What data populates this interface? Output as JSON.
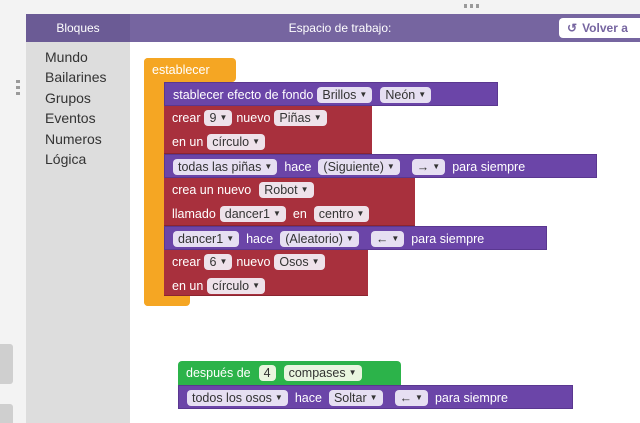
{
  "header": {
    "toolbox_title": "Bloques",
    "workspace_title": "Espacio de trabajo:",
    "back_label": "Volver a"
  },
  "categories": [
    "Mundo",
    "Bailarines",
    "Grupos",
    "Eventos",
    "Numeros",
    "Lógica"
  ],
  "stack1": {
    "hat": "establecer",
    "bg_effect": {
      "text": "stablecer efecto de fondo",
      "value1": "Brillos",
      "value2": "Neón"
    },
    "create1": {
      "text1": "crear",
      "count": "9",
      "text2": "nuevo",
      "kind": "Piñas",
      "text3": "en un",
      "shape": "círculo"
    },
    "all1": {
      "target": "todas las piñas",
      "text1": "hace",
      "move": "(Siguiente)",
      "dir": "→",
      "text2": "para siempre"
    },
    "newdancer": {
      "text1": "crea un nuevo",
      "kind": "Robot",
      "text2": "llamado",
      "name": "dancer1",
      "text3": "en",
      "pos": "centro"
    },
    "dancer1": {
      "target": "dancer1",
      "text1": "hace",
      "move": "(Aleatorio)",
      "dir": "←",
      "text2": "para siempre"
    },
    "create2": {
      "text1": "crear",
      "count": "6",
      "text2": "nuevo",
      "kind": "Osos",
      "text3": "en un",
      "shape": "círculo"
    }
  },
  "stack2": {
    "after": {
      "text1": "después de",
      "count": "4",
      "unit": "compases"
    },
    "all2": {
      "target": "todos los osos",
      "text1": "hace",
      "move": "Soltar",
      "dir": "←",
      "text2": "para siempre"
    }
  },
  "colors": {
    "header": "#7665a0",
    "orange": "#f5a623",
    "red": "#a8303d",
    "purple": "#6b45a8",
    "green": "#2cb34a"
  }
}
